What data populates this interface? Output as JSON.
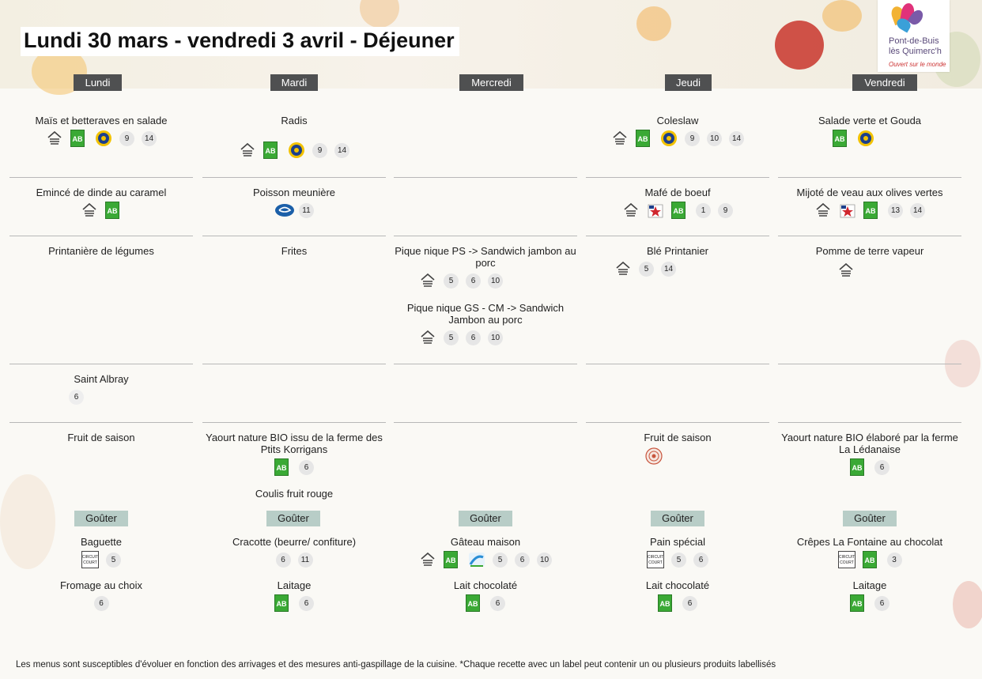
{
  "title": "Lundi 30 mars - vendredi 3 avril  - Déjeuner",
  "logo": {
    "line1": "Pont-de-Buis",
    "line2": "lès Quimerc'h",
    "slogan": "Ouvert sur le monde"
  },
  "days": [
    "Lundi",
    "Mardi",
    "Mercredi",
    "Jeudi",
    "Vendredi"
  ],
  "dishes": {
    "lundi": {
      "entree": "Maïs et betteraves en salade",
      "plat": "Emincé de dinde au caramel",
      "accomp": "Printanière de légumes",
      "fromage": "Saint Albray",
      "dessert": "Fruit de saison"
    },
    "mardi": {
      "entree": "Radis",
      "plat": "Poisson meunière",
      "accomp": "Frites",
      "dessert": "Yaourt nature BIO issu de la ferme des Ptits Korrigans",
      "dessert2": "Coulis fruit rouge"
    },
    "mercredi": {
      "pn1": "Pique nique PS -> Sandwich jambon au porc",
      "pn2": "Pique nique GS - CM  -> Sandwich Jambon au porc"
    },
    "jeudi": {
      "entree": "Coleslaw",
      "plat": "Mafé de boeuf",
      "accomp": "Blé Printanier",
      "dessert": "Fruit de saison"
    },
    "vendredi": {
      "entree": "Salade verte et Gouda",
      "plat": "Mijoté de veau aux olives vertes",
      "accomp": "Pomme de terre vapeur",
      "dessert": "Yaourt nature BIO élaboré par la ferme La Lédanaise"
    }
  },
  "allergens": {
    "lundi_entree": [
      "9",
      "14"
    ],
    "mardi_entree": [
      "9",
      "14"
    ],
    "jeudi_entree": [
      "9",
      "10",
      "14"
    ],
    "mardi_plat": [
      "11"
    ],
    "jeudi_plat": [
      "1",
      "9"
    ],
    "vendredi_plat": [
      "13",
      "14"
    ],
    "pn1": [
      "5",
      "6",
      "10"
    ],
    "pn2": [
      "5",
      "6",
      "10"
    ],
    "jeudi_accomp": [
      "5",
      "14"
    ],
    "lundi_fromage": [
      "6"
    ],
    "mardi_dessert": [
      "6"
    ],
    "vendredi_dessert": [
      "6"
    ]
  },
  "gouter": {
    "label": "Goûter",
    "lundi": {
      "item1": "Baguette",
      "a1": [
        "5"
      ],
      "item2": "Fromage au choix",
      "a2": [
        "6"
      ]
    },
    "mardi": {
      "item1": "Cracotte (beurre/ confiture)",
      "a1": [
        "6",
        "11"
      ],
      "item2": "Laitage",
      "a2": [
        "6"
      ]
    },
    "mercredi": {
      "item1": "Gâteau maison",
      "a1": [
        "5",
        "6",
        "10"
      ],
      "item2": "Lait chocolaté",
      "a2": [
        "6"
      ]
    },
    "jeudi": {
      "item1": "Pain spécial",
      "a1": [
        "5",
        "6"
      ],
      "item2": "Lait chocolaté",
      "a2": [
        "6"
      ]
    },
    "vendredi": {
      "item1": "Crêpes La Fontaine au chocolat",
      "a1": [
        "3"
      ],
      "item2": "Laitage",
      "a2": [
        "6"
      ]
    }
  },
  "labels": {
    "ab": "AB",
    "circuit_court": "CIRCUIT COURT"
  },
  "colors": {
    "day_header": "#4f5051",
    "gouter_header": "#b8cdc7",
    "ab_green": "#3aa935",
    "separator": "#b8b8b8"
  },
  "footer": "Les menus sont susceptibles d'évoluer en fonction des arrivages et des mesures anti-gaspillage de la cuisine. *Chaque recette avec un label peut contenir un ou plusieurs produits labellisés"
}
